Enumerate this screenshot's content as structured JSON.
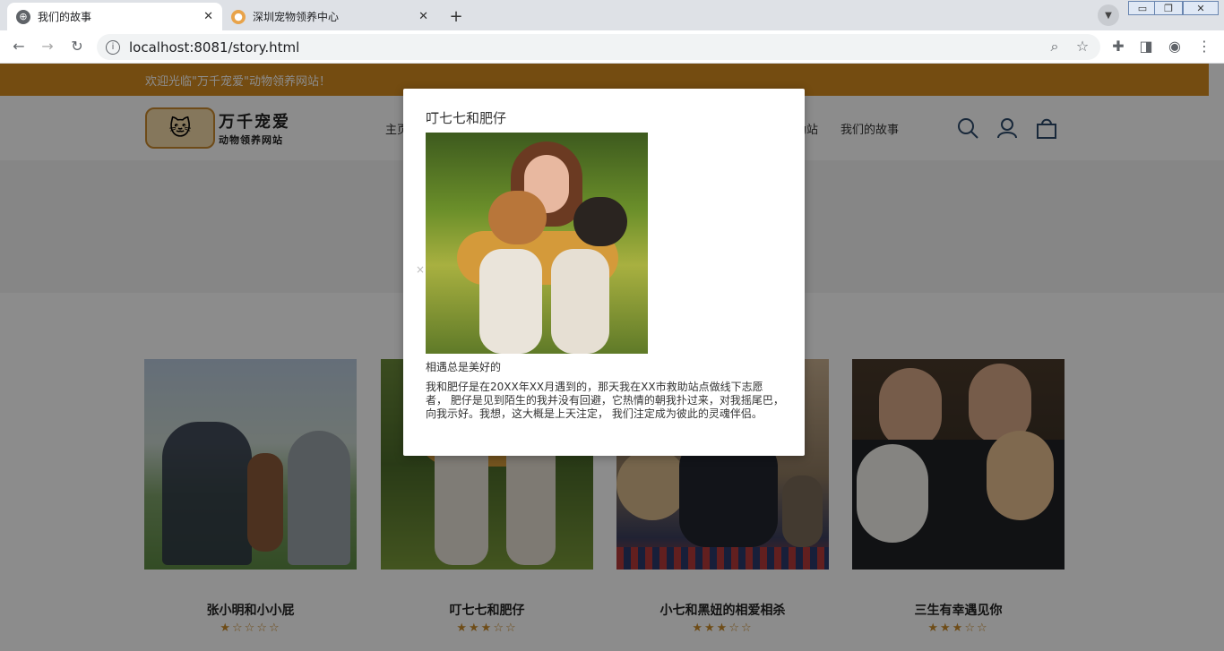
{
  "browser": {
    "tabs": [
      {
        "label": "我们的故事",
        "active": true
      },
      {
        "label": "深圳宠物领养中心",
        "active": false
      }
    ],
    "url": "localhost:8081/story.html"
  },
  "site": {
    "welcome": "欢迎光临\"万千宠爱\"动物领养网站！",
    "logo_title": "万千宠爱",
    "logo_subtitle": "动物领养网站",
    "nav": [
      "主页",
      "助站",
      "我们的故事"
    ]
  },
  "cards": [
    {
      "title": "张小明和小小屁",
      "rating": 1.5,
      "stars": "★☆☆☆☆"
    },
    {
      "title": "叮七七和肥仔",
      "rating": 3.5,
      "stars": "★★★☆☆"
    },
    {
      "title": "小七和黑妞的相爱相杀",
      "rating": 3.5,
      "stars": "★★★☆☆"
    },
    {
      "title": "三生有幸遇见你",
      "rating": 3.5,
      "stars": "★★★☆☆"
    }
  ],
  "modal": {
    "title": "叮七七和肥仔",
    "subtitle": "相遇总是美好的",
    "body": "我和肥仔是在20XX年XX月遇到的，那天我在XX市救助站点做线下志愿者， 肥仔是见到陌生的我并没有回避，它热情的朝我扑过来，对我摇尾巴，向我示好。我想，这大概是上天注定， 我们注定成为彼此的灵魂伴侣。",
    "close": "×"
  },
  "colors": {
    "accent": "#d38a20",
    "star": "#c88a2a"
  }
}
